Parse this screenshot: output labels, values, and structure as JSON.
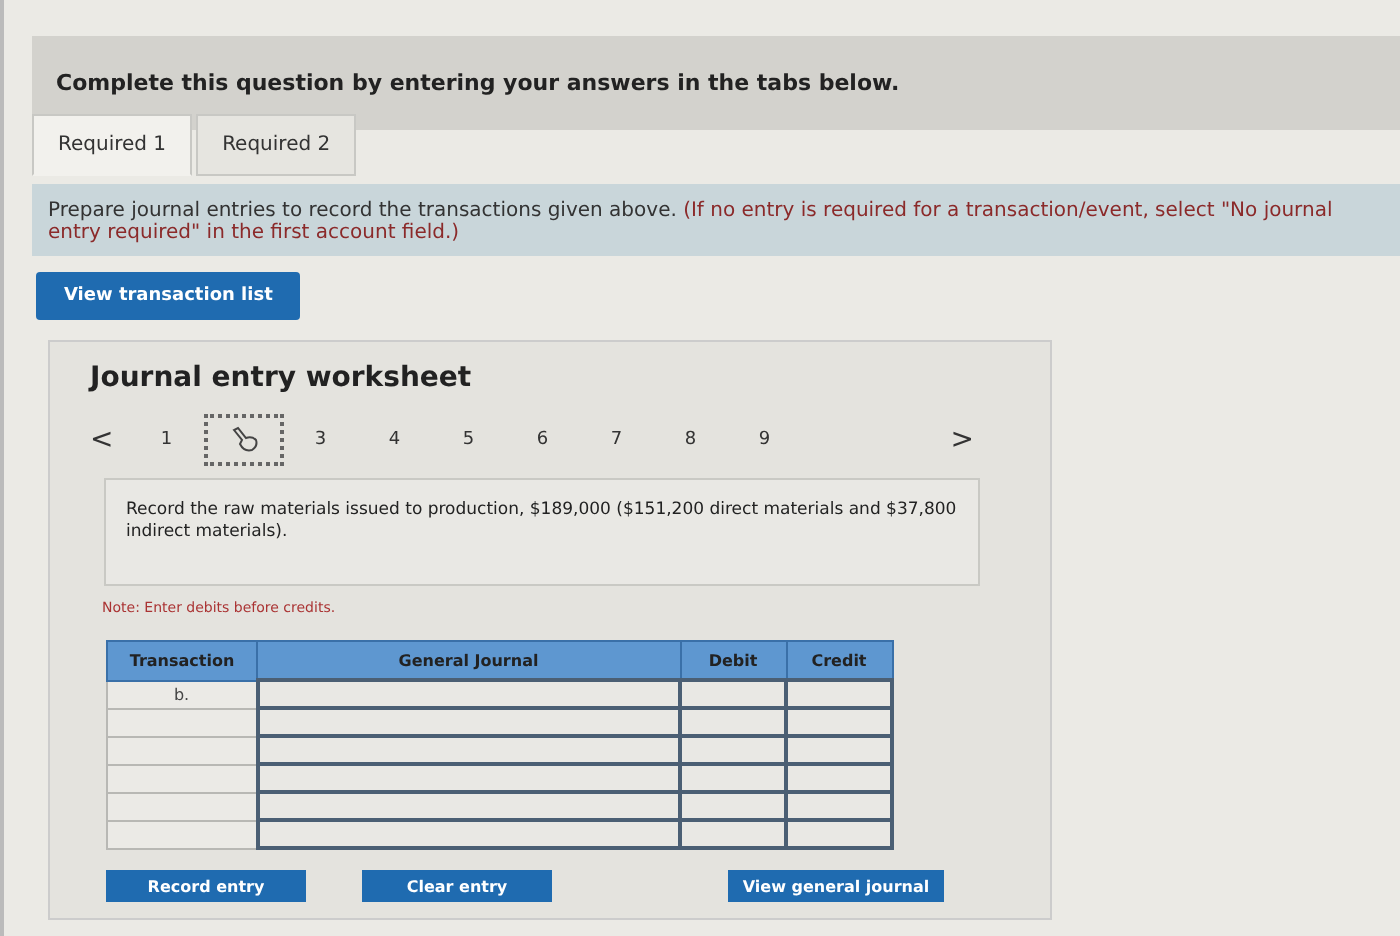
{
  "header": {
    "text": "Complete this question by entering your answers in the tabs below."
  },
  "tabs": [
    {
      "label": "Required 1",
      "selected": true
    },
    {
      "label": "Required 2",
      "selected": false
    }
  ],
  "instructions": {
    "text": "Prepare journal entries to record the transactions given above.",
    "note": "(If no entry is required for a transaction/event, select \"No journal entry required\" in the first account field.)"
  },
  "view_transaction_button": "View transaction list",
  "worksheet": {
    "title": "Journal entry worksheet",
    "prev": "<",
    "next": ">",
    "pages": [
      {
        "label": "1",
        "selected": false
      },
      {
        "selected": true
      },
      {
        "label": "3",
        "selected": false
      },
      {
        "label": "4",
        "selected": false
      },
      {
        "label": "5",
        "selected": false
      },
      {
        "label": "6",
        "selected": false
      },
      {
        "label": "7",
        "selected": false
      },
      {
        "label": "8",
        "selected": false
      },
      {
        "label": "9",
        "selected": false
      }
    ],
    "description": "Record the raw materials issued to production, $189,000 ($151,200 direct materials and $37,800 indirect materials).",
    "note": "Note: Enter debits before credits.",
    "table": {
      "columns": [
        "Transaction",
        "General Journal",
        "Debit",
        "Credit"
      ],
      "rows": [
        {
          "transaction": "b."
        },
        {},
        {},
        {},
        {},
        {}
      ]
    },
    "buttons": [
      "Record entry",
      "Clear entry",
      "View general journal"
    ]
  }
}
